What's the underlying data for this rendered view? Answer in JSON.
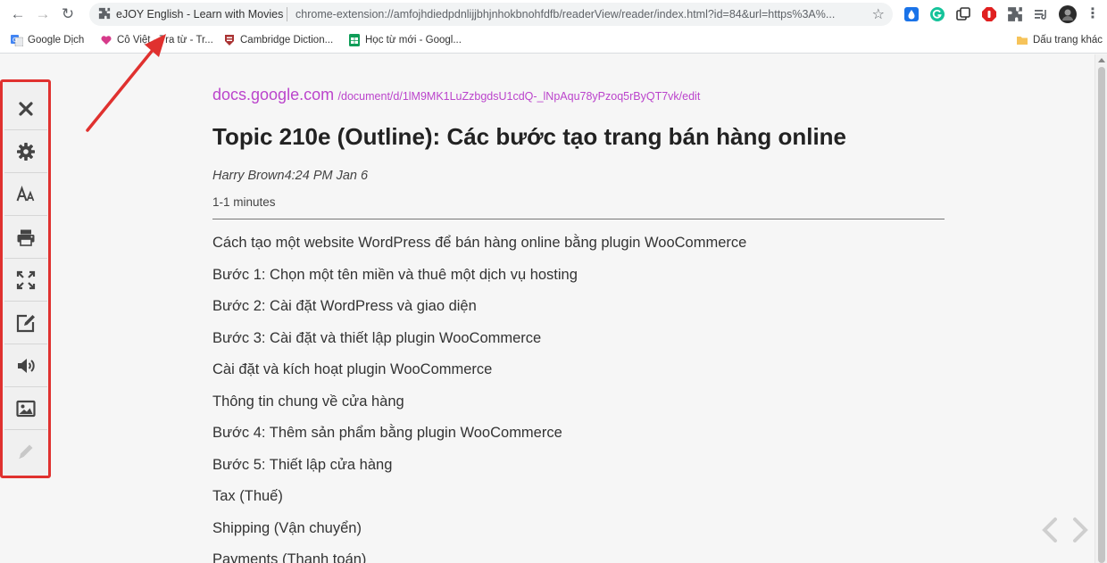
{
  "browser": {
    "omnibox_title": "eJOY English - Learn with Movies",
    "omnibox_url": "chrome-extension://amfojhdiedpdnlijjbhjnhokbnohfdfb/readerView/reader/index.html?id=84&url=https%3A%..."
  },
  "bookmarks": [
    {
      "label": "Google Dịch",
      "icon": "translate-icon"
    },
    {
      "label": "Cô Việt - Tra từ - Tr...",
      "icon": "heart-icon"
    },
    {
      "label": "Cambridge Diction...",
      "icon": "cambridge-icon"
    },
    {
      "label": "Học từ mới - Googl...",
      "icon": "sheets-icon"
    },
    {
      "label": "Dấu trang khác",
      "icon": "folder-icon"
    }
  ],
  "toolbar": [
    {
      "icon": "close-icon"
    },
    {
      "icon": "gear-icon"
    },
    {
      "icon": "font-size-icon"
    },
    {
      "icon": "print-icon"
    },
    {
      "icon": "fullscreen-icon"
    },
    {
      "icon": "edit-note-icon"
    },
    {
      "icon": "speaker-icon"
    },
    {
      "icon": "image-icon"
    },
    {
      "icon": "pencil-icon"
    }
  ],
  "article": {
    "domain": "docs.google.com",
    "path": "/document/d/1lM9MK1LuZzbgdsU1cdQ-_lNpAqu78yPzoq5rByQT7vk/edit",
    "title": "Topic 210e (Outline): Các bước tạo trang bán hàng online",
    "author_time": "Harry Brown4:24 PM Jan 6",
    "read_time": "1-1 minutes",
    "paragraphs": [
      "Cách tạo một website WordPress để bán hàng online bằng plugin WooCommerce",
      "Bước 1: Chọn một tên miền và thuê một dịch vụ hosting",
      "Bước 2: Cài đặt WordPress và giao diện",
      "Bước 3: Cài đặt và thiết lập plugin WooCommerce",
      "Cài đặt và kích hoạt plugin WooCommerce",
      "Thông tin chung về cửa hàng",
      "Bước 4: Thêm sản phẩm bằng plugin WooCommerce",
      "Bước 5: Thiết lập cửa hàng",
      "Tax (Thuế)",
      "Shipping (Vận chuyển)",
      "Payments (Thanh toán)"
    ]
  },
  "colors": {
    "accent_link": "#bb44cc",
    "annotation_red": "#e0312f"
  }
}
